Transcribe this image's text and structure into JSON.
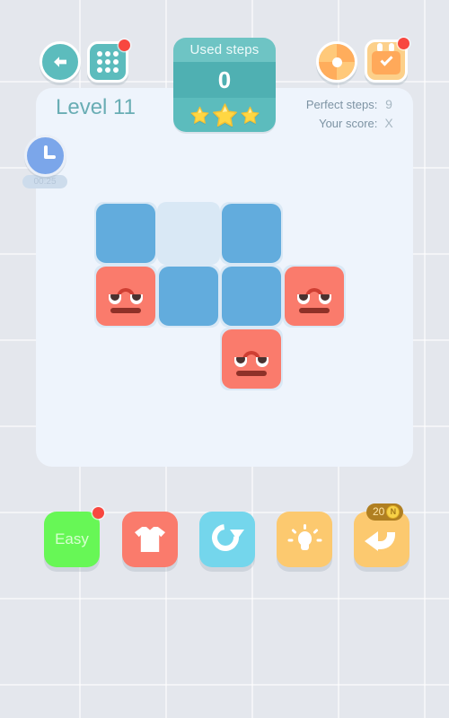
{
  "header": {
    "back_icon": "back-arrow-icon",
    "levels_icon": "grid-levels-icon",
    "wheel_icon": "fortune-wheel-icon",
    "calendar_icon": "calendar-check-icon"
  },
  "steps_panel": {
    "title": "Used steps",
    "value": "0",
    "stars_earned": 3,
    "stars_total": 3
  },
  "level": {
    "title": "Level 11",
    "perfect_steps_label": "Perfect steps:",
    "perfect_steps_value": "9",
    "your_score_label": "Your score:",
    "your_score_value": "X"
  },
  "timer": {
    "icon": "clock-icon",
    "value": "00:25"
  },
  "board": {
    "rows": 3,
    "cols": 4,
    "cell_size": 70,
    "colors": {
      "blue": "#62acdd",
      "red": "#fa7b6c",
      "empty": "#d9e8f5"
    },
    "cells": [
      {
        "row": 0,
        "col": 0,
        "type": "blue"
      },
      {
        "row": 0,
        "col": 1,
        "type": "empty"
      },
      {
        "row": 0,
        "col": 2,
        "type": "blue"
      },
      {
        "row": 1,
        "col": 0,
        "type": "red"
      },
      {
        "row": 1,
        "col": 1,
        "type": "blue"
      },
      {
        "row": 1,
        "col": 2,
        "type": "blue"
      },
      {
        "row": 1,
        "col": 3,
        "type": "red"
      },
      {
        "row": 2,
        "col": 2,
        "type": "red"
      }
    ]
  },
  "toolbar": {
    "easy_label": "Easy",
    "easy_has_badge": true,
    "skin_icon": "tshirt-icon",
    "restart_icon": "restart-icon",
    "hint_icon": "lightbulb-icon",
    "undo_icon": "undo-arrow-icon",
    "undo_cost": "20",
    "undo_currency": "N"
  },
  "colors": {
    "background": "#e4e7ed",
    "panel": "#eef4fc",
    "teal": "#5cbcbd",
    "teal_dark": "#4fb0b2",
    "orange": "#fcc96f",
    "green": "#67f756",
    "red_badge": "#f8473f"
  }
}
